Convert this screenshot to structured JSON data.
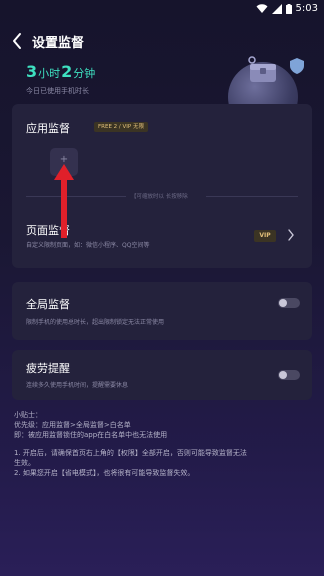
{
  "status_bar": {
    "time": "5:03"
  },
  "header": {
    "title": "设置监督"
  },
  "usage": {
    "hours": "3",
    "hours_unit": "小时",
    "minutes": "2",
    "minutes_unit": "分钟",
    "description": "今日已使用手机时长"
  },
  "app_monitor": {
    "title": "应用监督",
    "badge": "FREE 2 / VIP 无限",
    "add_symbol": "+",
    "hint": "【可缩放时以  长按移除",
    "page_monitor_title": "页面监督",
    "page_monitor_desc": "自定义限制页面，如：微信小程序、QQ空间等",
    "vip_tag": "VIP"
  },
  "global_monitor": {
    "title": "全局监督",
    "desc": "限制手机的使用总时长，超出限制锁定无法正常使用",
    "enabled": false
  },
  "fatigue_reminder": {
    "title": "疲劳提醒",
    "desc": "连续多久使用手机时间，提醒需要休息",
    "enabled": false
  },
  "notes": {
    "heading": "小贴士：",
    "line1": "优先级：应用监督>全局监督>白名单",
    "line2": "即：被应用监督锁住的app在白名单中也无法使用",
    "line3": "1. 开启后，请确保首页右上角的【权限】全部开启，否则可能导致监督无法",
    "line3b": "生效。",
    "line4": "2. 如果您开启【省电模式】，也将很有可能导致监督失效。"
  },
  "colors": {
    "accent": "#3ee0c0",
    "card": "#24223c",
    "arrow": "#e0202a",
    "vip": "#e2c07a"
  }
}
